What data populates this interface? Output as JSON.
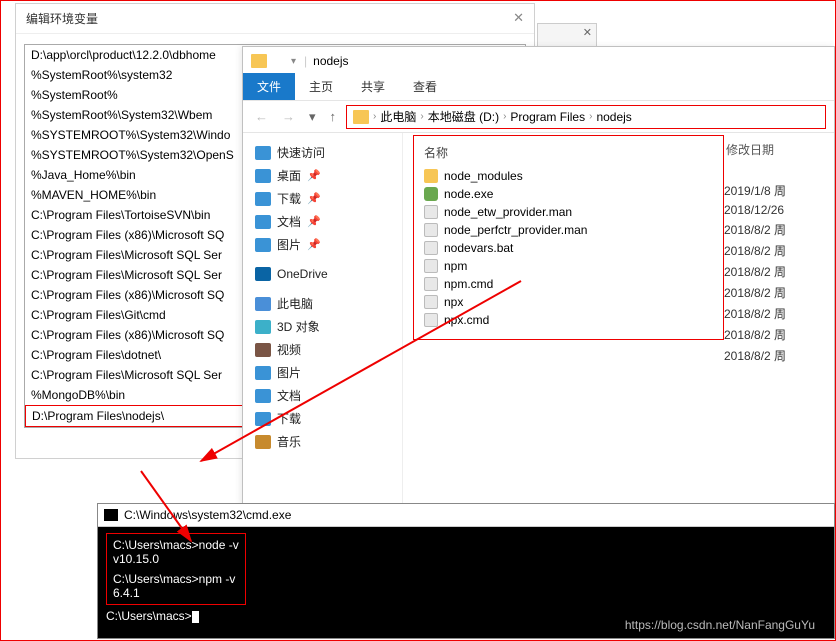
{
  "env": {
    "title": "编辑环境变量",
    "items": [
      "D:\\app\\orcl\\product\\12.2.0\\dbhome",
      "%SystemRoot%\\system32",
      "%SystemRoot%",
      "%SystemRoot%\\System32\\Wbem",
      "%SYSTEMROOT%\\System32\\Windo",
      "%SYSTEMROOT%\\System32\\OpenS",
      "%Java_Home%\\bin",
      "%MAVEN_HOME%\\bin",
      "C:\\Program Files\\TortoiseSVN\\bin",
      "C:\\Program Files (x86)\\Microsoft SQ",
      "C:\\Program Files\\Microsoft SQL Ser",
      "C:\\Program Files\\Microsoft SQL Ser",
      "C:\\Program Files (x86)\\Microsoft SQ",
      "C:\\Program Files\\Git\\cmd",
      "C:\\Program Files (x86)\\Microsoft SQ",
      "C:\\Program Files\\dotnet\\",
      "C:\\Program Files\\Microsoft SQL Ser",
      "%MongoDB%\\bin",
      "D:\\Program Files\\nodejs\\"
    ]
  },
  "explorer": {
    "title": "nodejs",
    "tabs": {
      "file": "文件",
      "home": "主页",
      "share": "共享",
      "view": "查看"
    },
    "path": {
      "root": "此电脑",
      "drive": "本地磁盘 (D:)",
      "pf": "Program Files",
      "leaf": "nodejs"
    },
    "side": {
      "quick": "快速访问",
      "desktop": "桌面",
      "downloads": "下载",
      "docs": "文档",
      "pics": "图片",
      "onedrive": "OneDrive",
      "pc": "此电脑",
      "obj3d": "3D 对象",
      "video": "视频",
      "pics2": "图片",
      "docs2": "文档",
      "downloads2": "下载",
      "music": "音乐"
    },
    "cols": {
      "name": "名称",
      "date": "修改日期"
    },
    "files": [
      {
        "name": "node_modules",
        "type": "folder",
        "date": "2019/1/8 周"
      },
      {
        "name": "node.exe",
        "type": "exe",
        "date": "2018/12/26"
      },
      {
        "name": "node_etw_provider.man",
        "type": "file",
        "date": "2018/8/2 周"
      },
      {
        "name": "node_perfctr_provider.man",
        "type": "file",
        "date": "2018/8/2 周"
      },
      {
        "name": "nodevars.bat",
        "type": "file",
        "date": "2018/8/2 周"
      },
      {
        "name": "npm",
        "type": "file",
        "date": "2018/8/2 周"
      },
      {
        "name": "npm.cmd",
        "type": "file",
        "date": "2018/8/2 周"
      },
      {
        "name": "npx",
        "type": "file",
        "date": "2018/8/2 周"
      },
      {
        "name": "npx.cmd",
        "type": "file",
        "date": "2018/8/2 周"
      }
    ]
  },
  "cmd": {
    "title": "C:\\Windows\\system32\\cmd.exe",
    "l1": "C:\\Users\\macs>node -v",
    "l2": "v10.15.0",
    "l3": "C:\\Users\\macs>npm -v",
    "l4": "6.4.1",
    "prompt": "C:\\Users\\macs>"
  },
  "watermark": "https://blog.csdn.net/NanFangGuYu"
}
